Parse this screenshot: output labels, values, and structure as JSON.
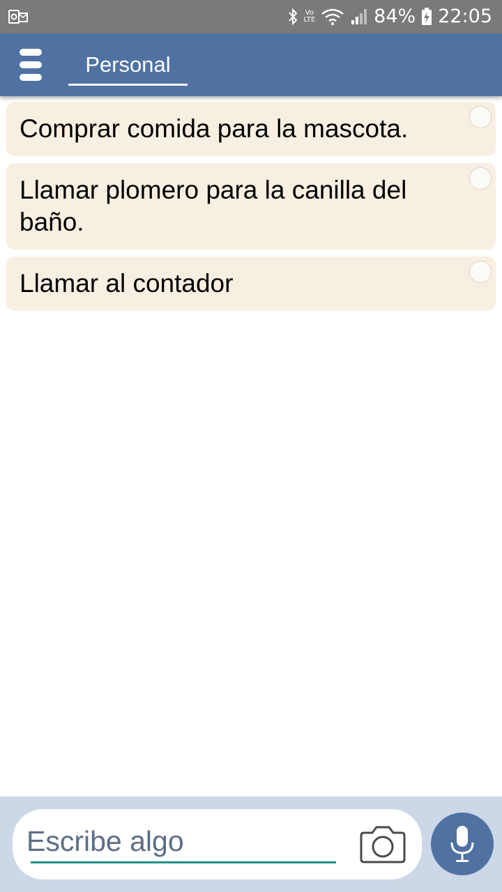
{
  "status_bar": {
    "left_icon": "outlook-notification-icon",
    "icons": [
      "bluetooth-icon",
      "volte-icon",
      "wifi-icon",
      "cell-signal-icon",
      "battery-charging-icon"
    ],
    "lte_badge_top": "Vo",
    "lte_badge_bottom": "LTE",
    "battery": "84%",
    "time": "22:05"
  },
  "app_bar": {
    "menu_icon": "hamburger-menu-icon",
    "active_tab": "Personal"
  },
  "tasks": [
    {
      "text": "Comprar comida para la mascota.",
      "done": false
    },
    {
      "text": "Llamar plomero para la canilla del baño.",
      "done": false
    },
    {
      "text": "Llamar al contador",
      "done": false
    }
  ],
  "composer": {
    "placeholder": "Escribe algo",
    "camera_icon": "camera-icon",
    "mic_icon": "microphone-icon"
  },
  "colors": {
    "app_bar": "#4f72a3",
    "status_bar": "#7a7a7a",
    "task_background": "#f7efe1",
    "composer_background": "#ccd7e7",
    "input_underline": "#1d9384"
  }
}
